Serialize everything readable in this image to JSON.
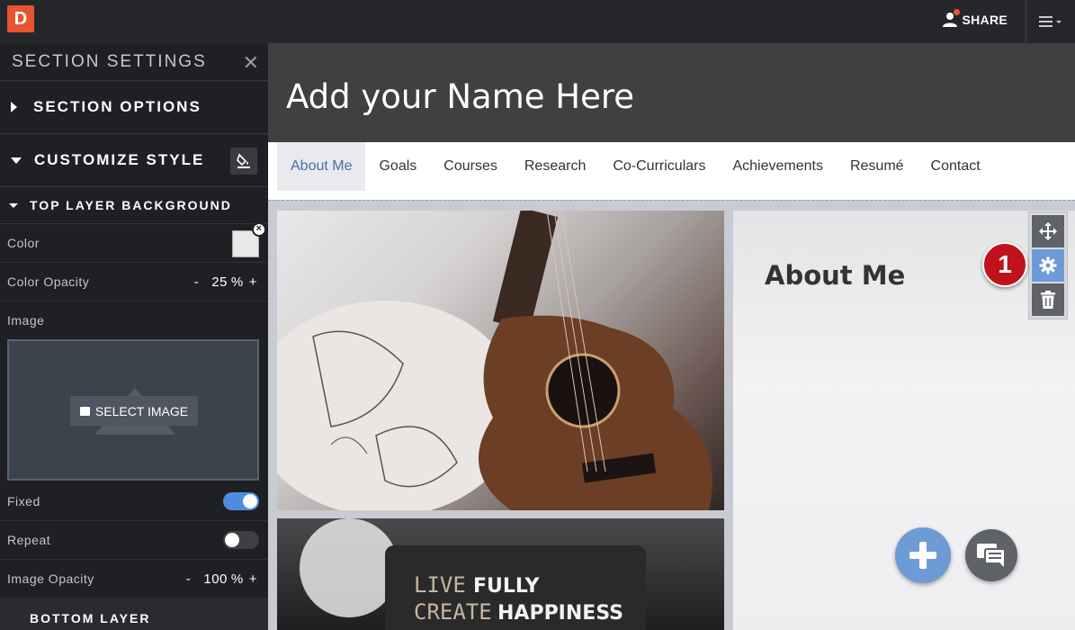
{
  "app": {
    "logo_letter": "D",
    "share_label": "SHARE",
    "accent": "#e8542f"
  },
  "sidebar": {
    "header": "SECTION SETTINGS",
    "section_options": "SECTION OPTIONS",
    "customize_style": "CUSTOMIZE STYLE",
    "top_layer": "TOP LAYER BACKGROUND",
    "color_label": "Color",
    "color_opacity_label": "Color Opacity",
    "color_opacity_value": "25",
    "image_label": "Image",
    "select_image": "SELECT IMAGE",
    "fixed_label": "Fixed",
    "fixed_on": true,
    "repeat_label": "Repeat",
    "repeat_on": false,
    "image_opacity_label": "Image Opacity",
    "image_opacity_value": "100",
    "percent_sign": "%",
    "minus": "-",
    "plus": "+",
    "bottom_layer": "BOTTOM LAYER"
  },
  "site": {
    "title": "Add your Name Here",
    "nav": [
      {
        "label": "About Me",
        "active": true
      },
      {
        "label": "Goals"
      },
      {
        "label": "Courses"
      },
      {
        "label": "Research"
      },
      {
        "label": "Co-Curriculars"
      },
      {
        "label": "Achievements"
      },
      {
        "label": "Resumé"
      },
      {
        "label": "Contact"
      }
    ],
    "about_title": "About Me",
    "photo_text_line1_a": "LIVE",
    "photo_text_line1_b": "FULLY",
    "photo_text_line2_a": "CREATE",
    "photo_text_line2_b": "HAPPINESS"
  },
  "callout": {
    "number": "1"
  },
  "icons": [
    "close-icon",
    "paint-bucket-icon",
    "image-icon",
    "move-icon",
    "gear-icon",
    "trash-icon",
    "plus-icon",
    "chat-icon",
    "user-icon",
    "hamburger-icon"
  ]
}
